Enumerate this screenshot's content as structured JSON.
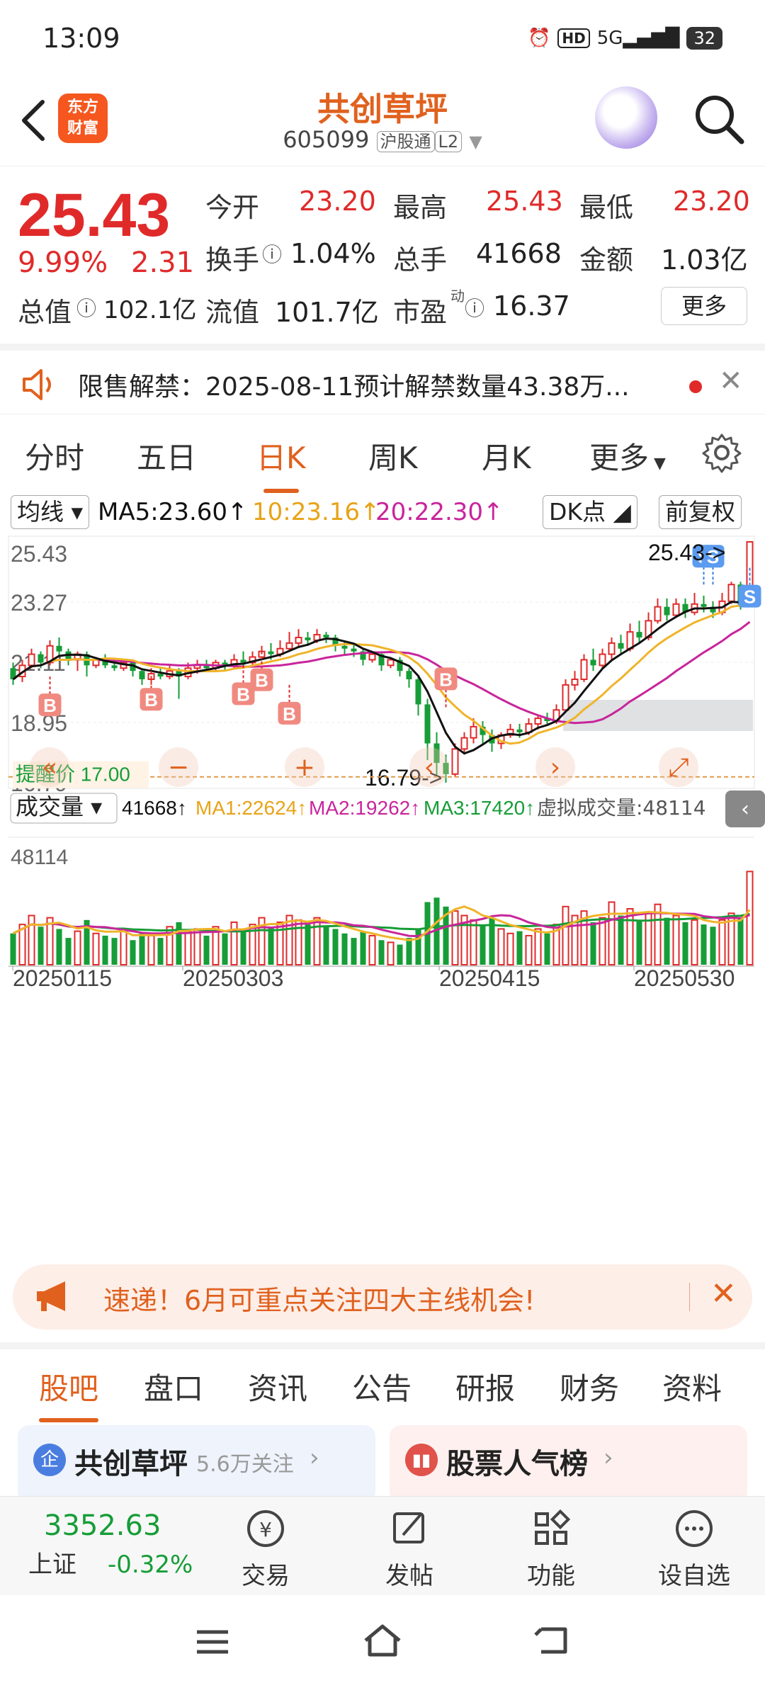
{
  "status_bar": {
    "time": "13:09",
    "signal": "5G",
    "hd": "HD",
    "battery": "32"
  },
  "header": {
    "logo_line1": "东方",
    "logo_line2": "财富",
    "stock_name": "共创草坪",
    "stock_code": "605099",
    "tag_market": "沪股通",
    "tag_level": "L2"
  },
  "quote": {
    "price": "25.43",
    "change_pct": "9.99%",
    "change": "2.31",
    "open_label": "今开",
    "open": "23.20",
    "high_label": "最高",
    "high": "25.43",
    "low_label": "最低",
    "low": "23.20",
    "turnover_label": "换手",
    "turnover": "1.04%",
    "volume_label": "总手",
    "volume": "41668",
    "amount_label": "金额",
    "amount": "1.03亿",
    "mktcap_label": "总值",
    "mktcap": "102.1亿",
    "float_label": "流值",
    "float": "101.7亿",
    "pe_label": "市盈",
    "pe_sup": "动",
    "pe": "16.37",
    "more": "更多"
  },
  "notice": {
    "text": "限售解禁：2025-08-11预计解禁数量43.38万..."
  },
  "kline_tabs": [
    "分时",
    "五日",
    "日K",
    "周K",
    "月K",
    "更多"
  ],
  "kline_active": 2,
  "ma_bar": {
    "selector": "均线",
    "ma5": "MA5:23.60",
    "ma10": "10:23.16",
    "ma20": "20:22.30",
    "dk": "DK点",
    "adjust": "前复权"
  },
  "colors": {
    "up": "#e02a2a",
    "down": "#169d37",
    "accent": "#e0611e",
    "ma5": "#111111",
    "ma10": "#f0b429",
    "ma20": "#c8259b"
  },
  "price_axis": [
    "25.43",
    "23.27",
    "21.11",
    "18.95",
    "16.79"
  ],
  "alert_label": "提醒价 17.00",
  "max_marker": "25.43->",
  "min_marker": "16.79->",
  "vol_bar": {
    "selector": "成交量",
    "vol": "41668",
    "ma1": "MA1:22624",
    "ma2": "MA2:19262",
    "ma3": "MA3:17420",
    "virtual": "虚拟成交量:48114"
  },
  "vol_axis_max": "48114",
  "date_axis": [
    "20250115",
    "20250303",
    "20250415",
    "20250530"
  ],
  "chart_data": {
    "type": "candlestick",
    "title": "",
    "ylim": [
      16.79,
      25.43
    ],
    "ohlc": [
      [
        20.9,
        20.5,
        21.1,
        20.3
      ],
      [
        20.6,
        21.0,
        21.2,
        20.4
      ],
      [
        21.0,
        21.4,
        21.6,
        20.9
      ],
      [
        21.4,
        21.1,
        21.5,
        20.9
      ],
      [
        21.1,
        21.7,
        21.9,
        21.0
      ],
      [
        21.7,
        21.5,
        22.0,
        21.3
      ],
      [
        21.5,
        21.2,
        21.6,
        21.0
      ],
      [
        21.2,
        21.4,
        21.5,
        20.8
      ],
      [
        21.4,
        21.0,
        21.5,
        20.6
      ],
      [
        21.0,
        21.2,
        21.3,
        20.9
      ],
      [
        21.2,
        21.0,
        21.4,
        20.9
      ],
      [
        21.0,
        20.9,
        21.2,
        20.8
      ],
      [
        20.9,
        21.1,
        21.2,
        20.8
      ],
      [
        21.1,
        20.8,
        21.2,
        20.6
      ],
      [
        20.8,
        20.5,
        20.9,
        20.3
      ],
      [
        20.5,
        20.7,
        20.9,
        20.3
      ],
      [
        20.7,
        20.6,
        20.9,
        20.5
      ],
      [
        20.6,
        20.8,
        21.0,
        20.5
      ],
      [
        20.8,
        20.6,
        20.9,
        19.8
      ],
      [
        20.6,
        20.9,
        21.1,
        20.5
      ],
      [
        20.9,
        21.0,
        21.2,
        20.7
      ],
      [
        21.0,
        20.9,
        21.2,
        20.8
      ],
      [
        20.9,
        21.1,
        21.2,
        20.8
      ],
      [
        21.1,
        21.0,
        21.2,
        20.8
      ],
      [
        21.0,
        21.2,
        21.4,
        20.9
      ],
      [
        21.2,
        21.1,
        21.5,
        20.9
      ],
      [
        21.1,
        21.3,
        21.5,
        21.0
      ],
      [
        21.3,
        21.5,
        21.7,
        21.2
      ],
      [
        21.5,
        21.4,
        21.8,
        21.2
      ],
      [
        21.4,
        21.6,
        21.9,
        21.3
      ],
      [
        21.6,
        21.8,
        22.2,
        21.5
      ],
      [
        21.8,
        22.0,
        22.3,
        21.7
      ],
      [
        22.0,
        21.9,
        22.2,
        21.7
      ],
      [
        21.9,
        22.1,
        22.3,
        21.8
      ],
      [
        22.1,
        22.0,
        22.2,
        21.8
      ],
      [
        22.0,
        21.7,
        22.1,
        21.5
      ],
      [
        21.7,
        21.6,
        21.9,
        21.4
      ],
      [
        21.6,
        21.5,
        21.8,
        21.3
      ],
      [
        21.5,
        21.2,
        21.6,
        21.0
      ],
      [
        21.2,
        21.4,
        21.5,
        21.1
      ],
      [
        21.4,
        21.0,
        21.5,
        20.8
      ],
      [
        21.0,
        21.2,
        21.3,
        20.9
      ],
      [
        21.2,
        20.8,
        21.3,
        20.6
      ],
      [
        20.8,
        20.5,
        20.9,
        20.2
      ],
      [
        20.5,
        19.6,
        20.6,
        19.2
      ],
      [
        19.6,
        18.2,
        19.8,
        17.6
      ],
      [
        18.2,
        17.5,
        18.6,
        17.0
      ],
      [
        17.5,
        17.1,
        17.8,
        16.79
      ],
      [
        17.1,
        18.0,
        18.2,
        17.0
      ],
      [
        18.0,
        18.4,
        18.6,
        17.8
      ],
      [
        18.4,
        18.8,
        19.1,
        18.2
      ],
      [
        18.8,
        18.5,
        19.0,
        18.2
      ],
      [
        18.5,
        18.2,
        18.7,
        17.9
      ],
      [
        18.2,
        18.5,
        18.6,
        18.0
      ],
      [
        18.5,
        18.7,
        18.9,
        18.4
      ],
      [
        18.7,
        18.6,
        18.9,
        18.4
      ],
      [
        18.6,
        18.9,
        19.1,
        18.5
      ],
      [
        18.9,
        19.1,
        19.2,
        18.7
      ],
      [
        19.1,
        19.0,
        19.3,
        18.9
      ],
      [
        19.0,
        19.4,
        19.6,
        18.9
      ],
      [
        19.4,
        20.3,
        20.5,
        19.3
      ],
      [
        20.3,
        20.5,
        20.8,
        20.1
      ],
      [
        20.5,
        21.2,
        21.4,
        20.4
      ],
      [
        21.2,
        21.0,
        21.6,
        20.8
      ],
      [
        21.0,
        21.4,
        21.6,
        20.9
      ],
      [
        21.4,
        21.8,
        22.0,
        21.2
      ],
      [
        21.8,
        21.6,
        22.1,
        21.4
      ],
      [
        21.6,
        22.2,
        22.5,
        21.5
      ],
      [
        22.2,
        22.0,
        22.6,
        21.8
      ],
      [
        22.0,
        22.6,
        22.9,
        21.9
      ],
      [
        22.6,
        23.1,
        23.4,
        22.5
      ],
      [
        23.1,
        22.8,
        23.4,
        22.6
      ],
      [
        22.8,
        23.2,
        23.4,
        22.7
      ],
      [
        23.2,
        22.9,
        23.4,
        22.7
      ],
      [
        22.9,
        23.2,
        23.6,
        22.8
      ],
      [
        23.2,
        23.1,
        23.5,
        22.9
      ],
      [
        23.1,
        22.9,
        23.3,
        22.7
      ],
      [
        22.9,
        23.3,
        23.6,
        22.8
      ],
      [
        23.3,
        23.9,
        24.0,
        23.2
      ],
      [
        23.9,
        23.1,
        24.0,
        23.0
      ],
      [
        23.2,
        25.43,
        25.43,
        23.2
      ]
    ],
    "volume": [
      14000,
      18000,
      22000,
      17000,
      21000,
      16000,
      12000,
      15000,
      20000,
      14000,
      13000,
      12000,
      16000,
      11000,
      14000,
      13000,
      12000,
      17000,
      19000,
      15000,
      16000,
      13000,
      17000,
      14000,
      19000,
      16000,
      18000,
      21000,
      17000,
      19000,
      22000,
      20000,
      18000,
      21000,
      17000,
      16000,
      14000,
      12000,
      15000,
      13000,
      11000,
      10000,
      9000,
      12000,
      16000,
      28000,
      30000,
      26000,
      24000,
      22000,
      20000,
      18000,
      21000,
      16000,
      14000,
      15000,
      13000,
      16000,
      14000,
      18000,
      26000,
      22000,
      24000,
      19000,
      21000,
      28000,
      22000,
      25000,
      20000,
      23000,
      27000,
      21000,
      22000,
      19000,
      20000,
      18000,
      17000,
      20000,
      23000,
      21000,
      41668
    ],
    "ma5": 23.6,
    "ma10": 23.16,
    "ma20": 22.3,
    "vol_ma1": 22624,
    "vol_ma2": 19262,
    "vol_ma3": 17420
  },
  "promo": {
    "text": "速递！6月可重点关注四大主线机会!"
  },
  "bottom_tabs": [
    "股吧",
    "盘口",
    "资讯",
    "公告",
    "研报",
    "财务",
    "资料"
  ],
  "bottom_active": 0,
  "cards": {
    "left_title": "共创草坪",
    "left_sub": "5.6万关注",
    "right_title": "股票人气榜"
  },
  "footer": {
    "index_value": "3352.63",
    "index_name": "上证",
    "index_change": "-0.32%",
    "items": [
      "交易",
      "发帖",
      "功能",
      "设自选"
    ]
  }
}
